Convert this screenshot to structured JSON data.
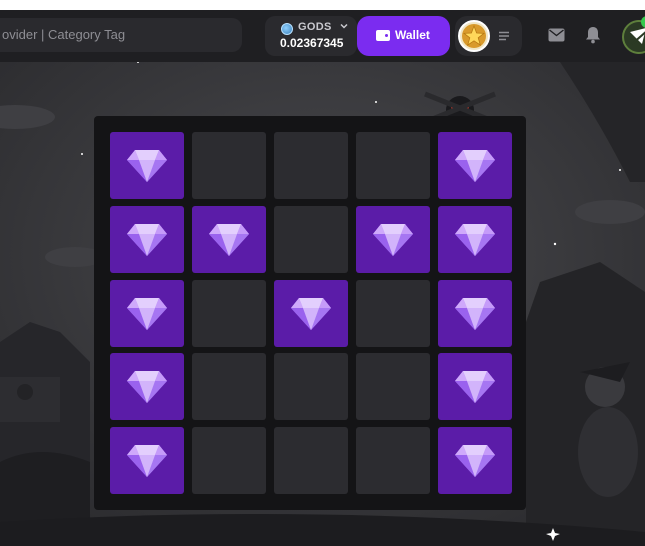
{
  "header": {
    "search_text": "ovider | Category Tag",
    "currency_code": "GODS",
    "balance": "0.02367345",
    "wallet_label": "Wallet"
  },
  "colors": {
    "accent": "#7b2cf0",
    "tile_revealed": "#5b1ca8",
    "tile_hidden": "#2c2c30",
    "gem": "#c9a6ff",
    "notification_dot": "#36c94e"
  },
  "icons": [
    "coin-icon",
    "chevron-down-icon",
    "wallet-icon",
    "star-avatar-icon",
    "menu-icon",
    "mail-icon",
    "bell-icon",
    "chat-icon",
    "gem-icon"
  ],
  "board": {
    "rows": 5,
    "cols": 5,
    "grid": [
      [
        "gem",
        "hidden",
        "hidden",
        "hidden",
        "gem"
      ],
      [
        "gem",
        "gem",
        "hidden",
        "gem",
        "gem"
      ],
      [
        "gem",
        "hidden",
        "gem",
        "hidden",
        "gem"
      ],
      [
        "gem",
        "hidden",
        "hidden",
        "hidden",
        "gem"
      ],
      [
        "gem",
        "hidden",
        "hidden",
        "hidden",
        "gem"
      ]
    ]
  }
}
